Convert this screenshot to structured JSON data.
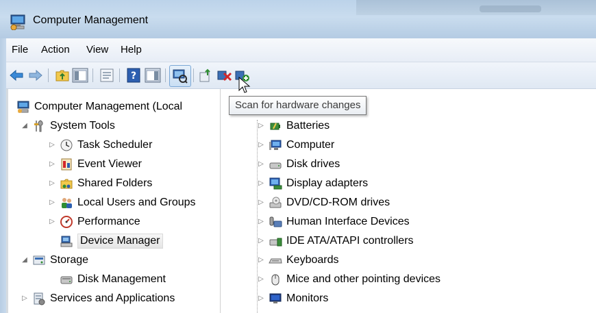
{
  "window": {
    "title": "Computer Management"
  },
  "menu": [
    "File",
    "Action",
    "View",
    "Help"
  ],
  "toolbar": {
    "buttons": [
      "back-arrow-icon",
      "forward-arrow-icon",
      "up-folder-icon",
      "show-hide-tree-icon",
      "properties-icon",
      "help-icon",
      "show-hide-action-pane-icon",
      "scan-hardware-icon",
      "update-driver-icon",
      "uninstall-icon",
      "enable-device-icon"
    ],
    "tooltip": "Scan for hardware changes"
  },
  "tree": {
    "root": "Computer Management (Local",
    "system_tools": "System Tools",
    "task_scheduler": "Task Scheduler",
    "event_viewer": "Event Viewer",
    "shared_folders": "Shared Folders",
    "local_users": "Local Users and Groups",
    "performance": "Performance",
    "device_manager": "Device Manager",
    "storage": "Storage",
    "disk_management": "Disk Management",
    "services": "Services and Applications"
  },
  "devices": [
    "Batteries",
    "Computer",
    "Disk drives",
    "Display adapters",
    "DVD/CD-ROM drives",
    "Human Interface Devices",
    "IDE ATA/ATAPI controllers",
    "Keyboards",
    "Mice and other pointing devices",
    "Monitors"
  ],
  "colors": {
    "title_bar": "#c9dcee",
    "selection": "#e5e5e5",
    "tooltip_border": "#767676"
  }
}
